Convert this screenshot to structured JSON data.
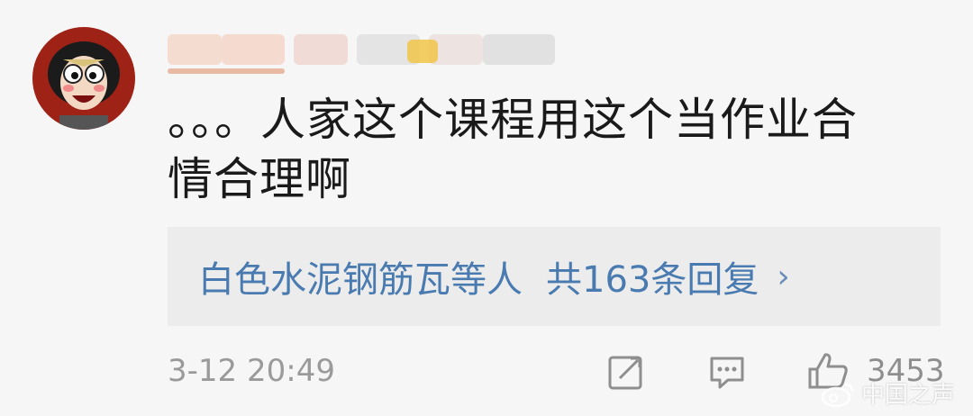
{
  "comment": {
    "text_line1": "。。。人家这个课程用这个当作业合",
    "text_line2": "情合理啊"
  },
  "replies": {
    "names": "白色水泥钢筋瓦等人",
    "count_label": "共163条回复",
    "chevron": "›"
  },
  "meta": {
    "timestamp": "3-12 20:49",
    "like_count": "3453"
  },
  "icons": {
    "share": "share-icon",
    "comment": "comment-icon",
    "like": "thumbs-up-icon"
  },
  "watermark": {
    "text": "中国之声"
  },
  "colors": {
    "background": "#f6f6f6",
    "link": "#4a7bb0",
    "meta": "#9a9a9a",
    "reply_bg": "#ececec"
  }
}
